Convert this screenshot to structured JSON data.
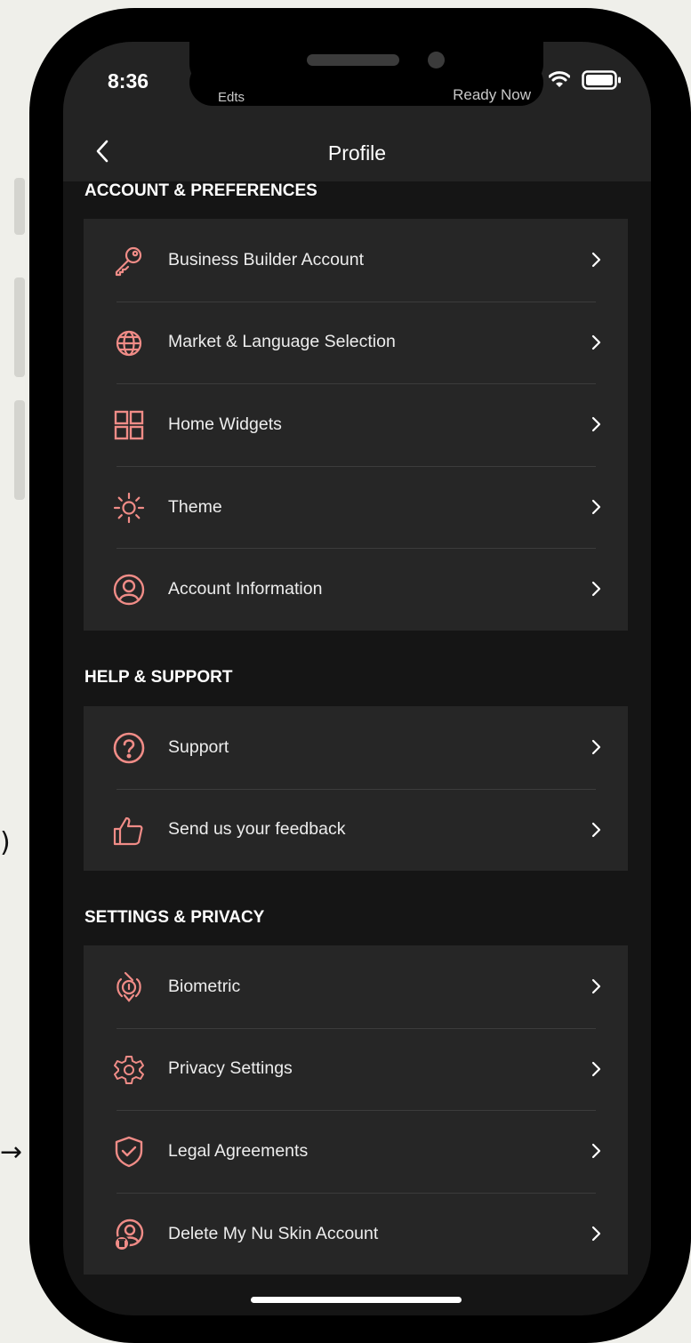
{
  "colors": {
    "accent": "#f08c87",
    "background": "#151515",
    "card": "#262626",
    "header": "#232323",
    "text": "#ffffff"
  },
  "status_bar": {
    "time": "8:36",
    "notch_left_text": "Edts",
    "notch_right_text": "Ready Now",
    "icons": [
      "wifi-icon",
      "battery-icon"
    ]
  },
  "nav": {
    "back_icon": "chevron-left-icon",
    "title": "Profile"
  },
  "sections": [
    {
      "title": "ACCOUNT & PREFERENCES",
      "items": [
        {
          "label": "Business Builder Account",
          "icon": "key-icon"
        },
        {
          "label": "Market & Language Selection",
          "icon": "globe-icon"
        },
        {
          "label": "Home Widgets",
          "icon": "widgets-grid-icon"
        },
        {
          "label": "Theme",
          "icon": "sun-icon"
        },
        {
          "label": "Account Information",
          "icon": "user-circle-icon"
        }
      ]
    },
    {
      "title": "HELP & SUPPORT",
      "items": [
        {
          "label": "Support",
          "icon": "question-circle-icon"
        },
        {
          "label": "Send us your feedback",
          "icon": "thumbs-up-icon"
        }
      ]
    },
    {
      "title": "SETTINGS & PRIVACY",
      "items": [
        {
          "label": "Biometric",
          "icon": "face-scan-icon"
        },
        {
          "label": "Privacy Settings",
          "icon": "gear-icon"
        },
        {
          "label": "Legal Agreements",
          "icon": "shield-check-icon"
        },
        {
          "label": "Delete My Nu Skin Account",
          "icon": "user-delete-icon"
        }
      ]
    }
  ]
}
